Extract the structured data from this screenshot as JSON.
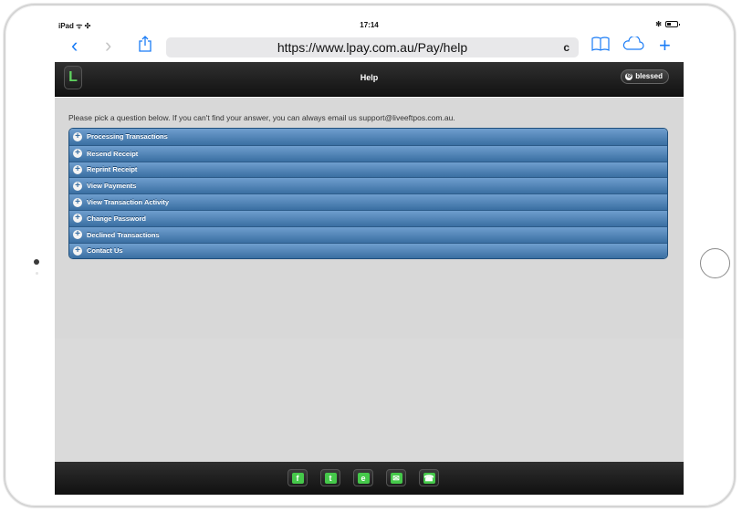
{
  "status": {
    "device": "iPad ᯤ ✣",
    "time": "17:14",
    "right": "✻"
  },
  "browser": {
    "url": "https://www.lpay.com.au/Pay/help",
    "back_icon": "‹",
    "forward_icon": "›",
    "reload_icon": "c",
    "plus_icon": "+"
  },
  "app": {
    "logo_letter": "L",
    "title": "Help",
    "user_label": "blessed",
    "intro": "Please pick a question below. If you can't find your answer, you can always email us support@liveeftpos.com.au."
  },
  "faq": [
    {
      "label": "Processing Transactions"
    },
    {
      "label": "Resend Receipt"
    },
    {
      "label": "Reprint Receipt"
    },
    {
      "label": "View Payments"
    },
    {
      "label": "View Transaction Activity"
    },
    {
      "label": "Change Password"
    },
    {
      "label": "Declined Transactions"
    },
    {
      "label": "Contact Us"
    }
  ],
  "footer": {
    "social": [
      {
        "name": "facebook-icon",
        "glyph": "f"
      },
      {
        "name": "twitter-icon",
        "glyph": "t"
      },
      {
        "name": "web-icon",
        "glyph": "e"
      },
      {
        "name": "email-icon",
        "glyph": "✉"
      },
      {
        "name": "phone-icon",
        "glyph": "☎"
      }
    ]
  },
  "colors": {
    "accent": "#1a7cf6",
    "faq_blue": "#3a6fa2",
    "icon_green": "#45c84a"
  }
}
